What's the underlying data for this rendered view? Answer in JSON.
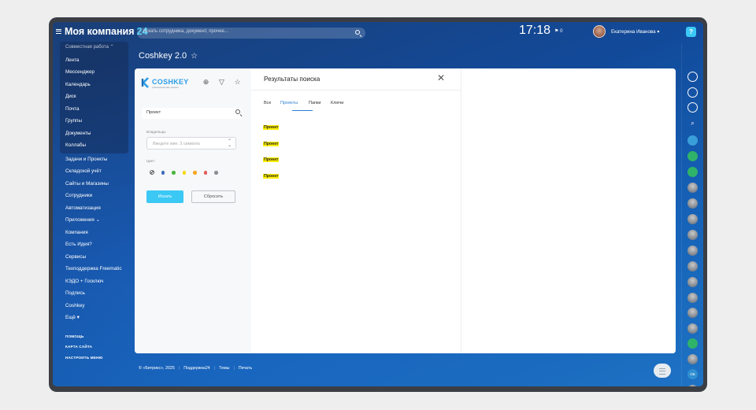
{
  "header": {
    "brand": "Моя компания",
    "brand_number": "24",
    "search_placeholder": "искать сотрудника, документ, прочее...",
    "clock": "17:18",
    "flag_count": "0",
    "user_name": "Екатерина Иванова",
    "help_label": "?"
  },
  "menu": {
    "group_title": "Совместная работа",
    "group_items": [
      "Лента",
      "Мессенджер",
      "Календарь",
      "Диск",
      "Почта",
      "Группы",
      "Документы",
      "Коллабы"
    ],
    "items": [
      "Задачи и Проекты",
      "Складской учёт",
      "Сайты и Магазины",
      "Сотрудники",
      "Автоматизация",
      "Приложения",
      "Компания",
      "Есть Идея?",
      "Сервисы",
      "Техподдержка Freematic",
      "КЭДО + Госключ",
      "Подпись",
      "Coshkey",
      "Ещё"
    ],
    "footer_items": [
      "ПОМОЩЬ",
      "КАРТА САЙТА",
      "НАСТРОИТЬ МЕНЮ"
    ]
  },
  "page": {
    "title": "Coshkey 2.0",
    "star": "☆"
  },
  "app": {
    "logo_text": "COSHKEY",
    "logo_sub": "professional safe solution",
    "search_value": "Проект",
    "owners_label": "Владельцы",
    "owners_placeholder": "Введите мин. 3 символа",
    "color_label": "Цвет",
    "colors": [
      "#3f6db5",
      "#4bb543",
      "#f5d90a",
      "#f5a623",
      "#e35d5d",
      "#8a8f95"
    ],
    "search_button": "Искать",
    "reset_button": "Сбросить"
  },
  "results": {
    "title": "Результаты поиска",
    "close": "✕",
    "tabs": [
      "Все",
      "Проекты",
      "Папки",
      "Ключи"
    ],
    "active_tab": "Проекты",
    "items": [
      "Проект",
      "Проект",
      "Проект",
      "Проект"
    ]
  },
  "footer": {
    "copyright": "© «Битрикс», 2025",
    "links": [
      "Поддержка24",
      "Темы",
      "Печать"
    ]
  }
}
